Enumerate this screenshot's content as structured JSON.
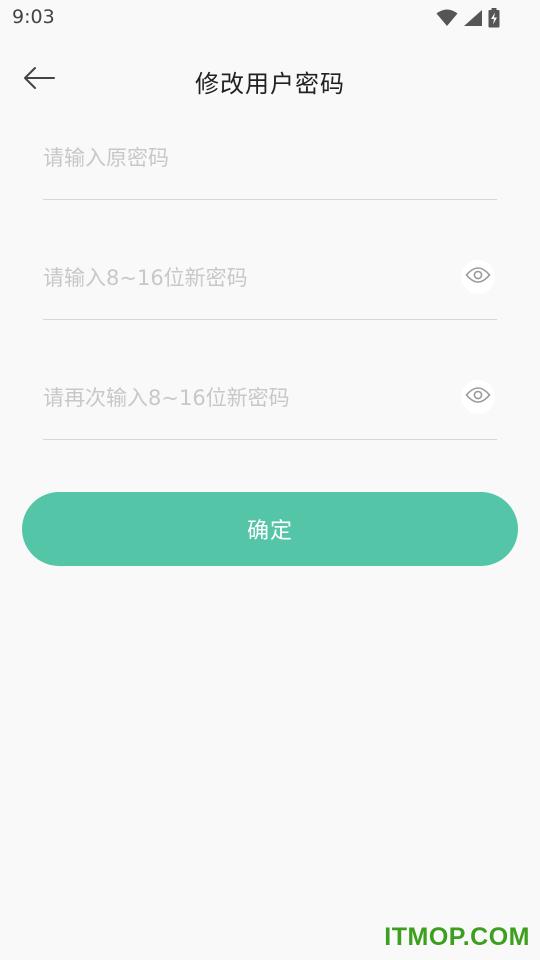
{
  "status_bar": {
    "time": "9:03",
    "icons": [
      "wifi-icon",
      "cell-signal-icon",
      "battery-charging-icon"
    ]
  },
  "header": {
    "back_icon": "arrow-left-icon",
    "title": "修改用户密码"
  },
  "form": {
    "old_password": {
      "value": "",
      "placeholder": "请输入原密码"
    },
    "new_password": {
      "value": "",
      "placeholder": "请输入8~16位新密码",
      "toggle_icon": "eye-icon"
    },
    "confirm_password": {
      "value": "",
      "placeholder": "请再次输入8~16位新密码",
      "toggle_icon": "eye-icon"
    },
    "submit_label": "确定"
  },
  "watermark": {
    "text": "ITMOP.COM"
  },
  "colors": {
    "accent": "#55c5a8",
    "background": "#f9f9f9",
    "divider": "#d8d8d8",
    "placeholder": "#c8c8c8",
    "watermark": "#3ca01e"
  }
}
